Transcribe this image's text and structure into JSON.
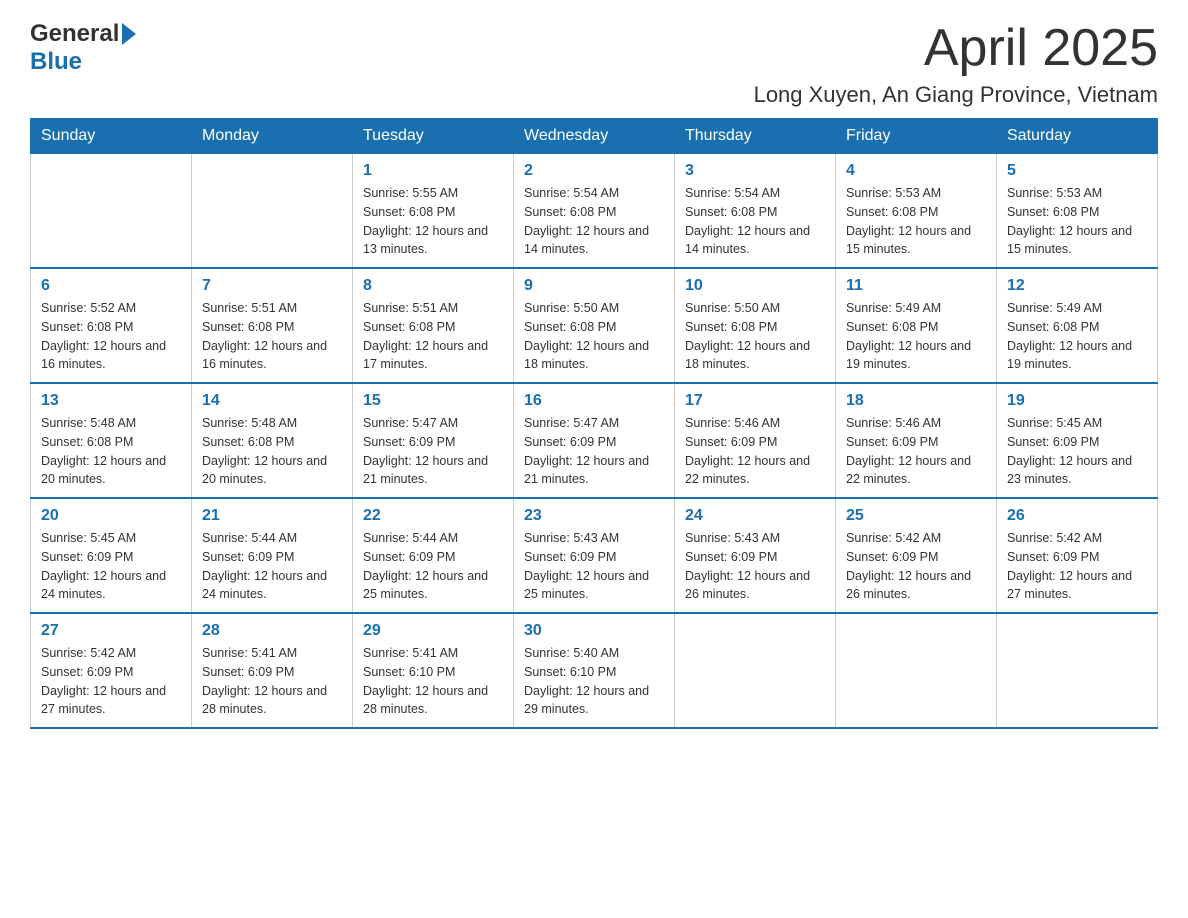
{
  "header": {
    "month_title": "April 2025",
    "location": "Long Xuyen, An Giang Province, Vietnam",
    "logo_general": "General",
    "logo_blue": "Blue"
  },
  "days_of_week": [
    "Sunday",
    "Monday",
    "Tuesday",
    "Wednesday",
    "Thursday",
    "Friday",
    "Saturday"
  ],
  "weeks": [
    [
      {
        "day": "",
        "sunrise": "",
        "sunset": "",
        "daylight": ""
      },
      {
        "day": "",
        "sunrise": "",
        "sunset": "",
        "daylight": ""
      },
      {
        "day": "1",
        "sunrise": "Sunrise: 5:55 AM",
        "sunset": "Sunset: 6:08 PM",
        "daylight": "Daylight: 12 hours and 13 minutes."
      },
      {
        "day": "2",
        "sunrise": "Sunrise: 5:54 AM",
        "sunset": "Sunset: 6:08 PM",
        "daylight": "Daylight: 12 hours and 14 minutes."
      },
      {
        "day": "3",
        "sunrise": "Sunrise: 5:54 AM",
        "sunset": "Sunset: 6:08 PM",
        "daylight": "Daylight: 12 hours and 14 minutes."
      },
      {
        "day": "4",
        "sunrise": "Sunrise: 5:53 AM",
        "sunset": "Sunset: 6:08 PM",
        "daylight": "Daylight: 12 hours and 15 minutes."
      },
      {
        "day": "5",
        "sunrise": "Sunrise: 5:53 AM",
        "sunset": "Sunset: 6:08 PM",
        "daylight": "Daylight: 12 hours and 15 minutes."
      }
    ],
    [
      {
        "day": "6",
        "sunrise": "Sunrise: 5:52 AM",
        "sunset": "Sunset: 6:08 PM",
        "daylight": "Daylight: 12 hours and 16 minutes."
      },
      {
        "day": "7",
        "sunrise": "Sunrise: 5:51 AM",
        "sunset": "Sunset: 6:08 PM",
        "daylight": "Daylight: 12 hours and 16 minutes."
      },
      {
        "day": "8",
        "sunrise": "Sunrise: 5:51 AM",
        "sunset": "Sunset: 6:08 PM",
        "daylight": "Daylight: 12 hours and 17 minutes."
      },
      {
        "day": "9",
        "sunrise": "Sunrise: 5:50 AM",
        "sunset": "Sunset: 6:08 PM",
        "daylight": "Daylight: 12 hours and 18 minutes."
      },
      {
        "day": "10",
        "sunrise": "Sunrise: 5:50 AM",
        "sunset": "Sunset: 6:08 PM",
        "daylight": "Daylight: 12 hours and 18 minutes."
      },
      {
        "day": "11",
        "sunrise": "Sunrise: 5:49 AM",
        "sunset": "Sunset: 6:08 PM",
        "daylight": "Daylight: 12 hours and 19 minutes."
      },
      {
        "day": "12",
        "sunrise": "Sunrise: 5:49 AM",
        "sunset": "Sunset: 6:08 PM",
        "daylight": "Daylight: 12 hours and 19 minutes."
      }
    ],
    [
      {
        "day": "13",
        "sunrise": "Sunrise: 5:48 AM",
        "sunset": "Sunset: 6:08 PM",
        "daylight": "Daylight: 12 hours and 20 minutes."
      },
      {
        "day": "14",
        "sunrise": "Sunrise: 5:48 AM",
        "sunset": "Sunset: 6:08 PM",
        "daylight": "Daylight: 12 hours and 20 minutes."
      },
      {
        "day": "15",
        "sunrise": "Sunrise: 5:47 AM",
        "sunset": "Sunset: 6:09 PM",
        "daylight": "Daylight: 12 hours and 21 minutes."
      },
      {
        "day": "16",
        "sunrise": "Sunrise: 5:47 AM",
        "sunset": "Sunset: 6:09 PM",
        "daylight": "Daylight: 12 hours and 21 minutes."
      },
      {
        "day": "17",
        "sunrise": "Sunrise: 5:46 AM",
        "sunset": "Sunset: 6:09 PM",
        "daylight": "Daylight: 12 hours and 22 minutes."
      },
      {
        "day": "18",
        "sunrise": "Sunrise: 5:46 AM",
        "sunset": "Sunset: 6:09 PM",
        "daylight": "Daylight: 12 hours and 22 minutes."
      },
      {
        "day": "19",
        "sunrise": "Sunrise: 5:45 AM",
        "sunset": "Sunset: 6:09 PM",
        "daylight": "Daylight: 12 hours and 23 minutes."
      }
    ],
    [
      {
        "day": "20",
        "sunrise": "Sunrise: 5:45 AM",
        "sunset": "Sunset: 6:09 PM",
        "daylight": "Daylight: 12 hours and 24 minutes."
      },
      {
        "day": "21",
        "sunrise": "Sunrise: 5:44 AM",
        "sunset": "Sunset: 6:09 PM",
        "daylight": "Daylight: 12 hours and 24 minutes."
      },
      {
        "day": "22",
        "sunrise": "Sunrise: 5:44 AM",
        "sunset": "Sunset: 6:09 PM",
        "daylight": "Daylight: 12 hours and 25 minutes."
      },
      {
        "day": "23",
        "sunrise": "Sunrise: 5:43 AM",
        "sunset": "Sunset: 6:09 PM",
        "daylight": "Daylight: 12 hours and 25 minutes."
      },
      {
        "day": "24",
        "sunrise": "Sunrise: 5:43 AM",
        "sunset": "Sunset: 6:09 PM",
        "daylight": "Daylight: 12 hours and 26 minutes."
      },
      {
        "day": "25",
        "sunrise": "Sunrise: 5:42 AM",
        "sunset": "Sunset: 6:09 PM",
        "daylight": "Daylight: 12 hours and 26 minutes."
      },
      {
        "day": "26",
        "sunrise": "Sunrise: 5:42 AM",
        "sunset": "Sunset: 6:09 PM",
        "daylight": "Daylight: 12 hours and 27 minutes."
      }
    ],
    [
      {
        "day": "27",
        "sunrise": "Sunrise: 5:42 AM",
        "sunset": "Sunset: 6:09 PM",
        "daylight": "Daylight: 12 hours and 27 minutes."
      },
      {
        "day": "28",
        "sunrise": "Sunrise: 5:41 AM",
        "sunset": "Sunset: 6:09 PM",
        "daylight": "Daylight: 12 hours and 28 minutes."
      },
      {
        "day": "29",
        "sunrise": "Sunrise: 5:41 AM",
        "sunset": "Sunset: 6:10 PM",
        "daylight": "Daylight: 12 hours and 28 minutes."
      },
      {
        "day": "30",
        "sunrise": "Sunrise: 5:40 AM",
        "sunset": "Sunset: 6:10 PM",
        "daylight": "Daylight: 12 hours and 29 minutes."
      },
      {
        "day": "",
        "sunrise": "",
        "sunset": "",
        "daylight": ""
      },
      {
        "day": "",
        "sunrise": "",
        "sunset": "",
        "daylight": ""
      },
      {
        "day": "",
        "sunrise": "",
        "sunset": "",
        "daylight": ""
      }
    ]
  ]
}
